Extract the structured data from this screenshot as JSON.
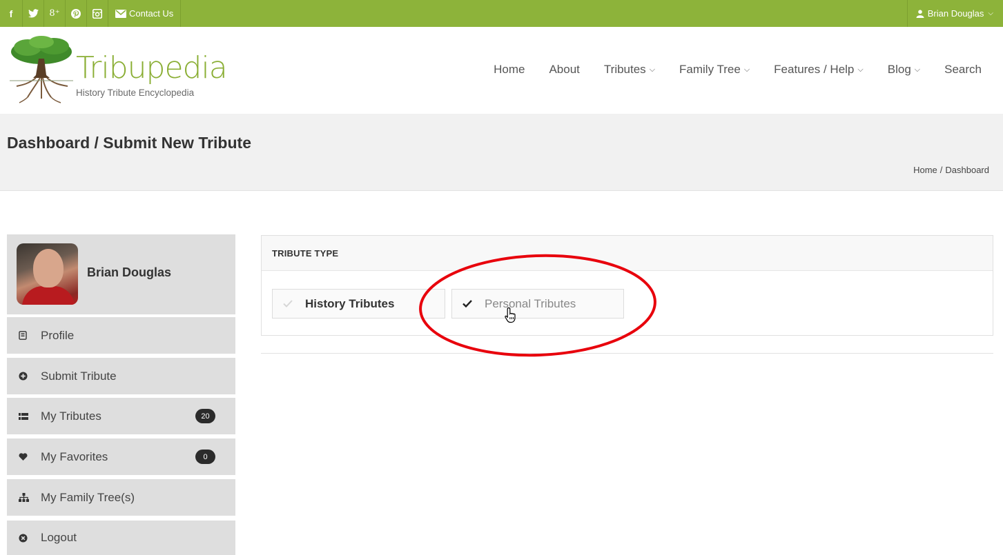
{
  "topbar": {
    "social_icons": [
      "facebook-icon",
      "twitter-icon",
      "google-plus-icon",
      "pinterest-icon",
      "instagram-icon"
    ],
    "google_plus_glyph": "8⁺",
    "contact_label": "Contact Us",
    "user_name": "Brian Douglas",
    "color": "#8db33a"
  },
  "header": {
    "brand": "Tribupedia",
    "tagline": "History Tribute Encyclopedia",
    "nav": [
      {
        "label": "Home",
        "dropdown": false
      },
      {
        "label": "About",
        "dropdown": false
      },
      {
        "label": "Tributes",
        "dropdown": true
      },
      {
        "label": "Family Tree",
        "dropdown": true
      },
      {
        "label": "Features / Help",
        "dropdown": true
      },
      {
        "label": "Blog",
        "dropdown": true
      },
      {
        "label": "Search",
        "dropdown": false
      }
    ]
  },
  "page": {
    "title": "Dashboard / Submit New Tribute",
    "breadcrumb": [
      "Home",
      "Dashboard"
    ],
    "breadcrumb_sep": "/"
  },
  "sidebar": {
    "user_name": "Brian Douglas",
    "items": [
      {
        "label": "Profile",
        "icon": "profile-icon"
      },
      {
        "label": "Submit Tribute",
        "icon": "plus-circle-icon"
      },
      {
        "label": "My Tributes",
        "icon": "grid-list-icon",
        "badge": "20"
      },
      {
        "label": "My Favorites",
        "icon": "heart-icon",
        "badge": "0"
      },
      {
        "label": "My Family Tree(s)",
        "icon": "sitemap-icon"
      },
      {
        "label": "Logout",
        "icon": "close-circle-icon"
      }
    ]
  },
  "main": {
    "section_title": "TRIBUTE TYPE",
    "options": [
      {
        "label": "History Tributes",
        "selected": false
      },
      {
        "label": "Personal Tributes",
        "selected": true
      }
    ],
    "annotation_color": "#e8000c"
  }
}
